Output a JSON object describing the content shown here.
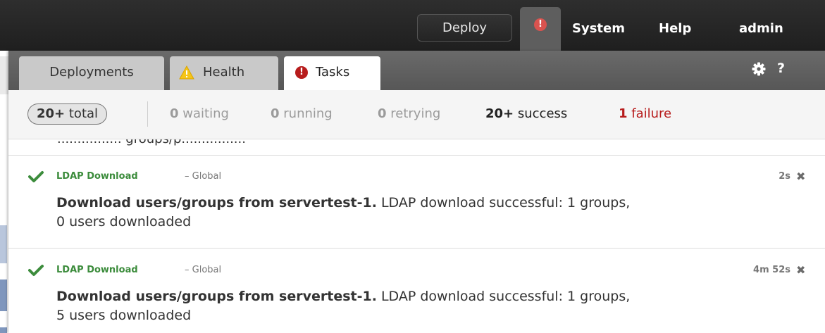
{
  "topbar": {
    "deploy_label": "Deploy",
    "alert_glyph": "!",
    "nav": {
      "system": "System",
      "help": "Help",
      "user": "admin"
    }
  },
  "tabs": {
    "deployments": "Deployments",
    "health": "Health",
    "tasks": "Tasks",
    "active": "Tasks",
    "help_glyph": "?"
  },
  "summary": {
    "total_count": "20+",
    "total_label": "total",
    "waiting_count": "0",
    "waiting_label": "waiting",
    "running_count": "0",
    "running_label": "running",
    "retrying_count": "0",
    "retrying_label": "retrying",
    "success_count": "20+",
    "success_label": "success",
    "failure_count": "1",
    "failure_label": "failure"
  },
  "tasks": [
    {
      "type": "LDAP Download",
      "scope": "– Global",
      "elapsed": "2s",
      "title": "Download users/groups from servertest-1.",
      "message": "LDAP download successful: 1 groups, 0 users downloaded",
      "status": "success"
    },
    {
      "type": "LDAP Download",
      "scope": "– Global",
      "elapsed": "4m 52s",
      "title": "Download users/groups from servertest-1.",
      "message": "LDAP download successful: 1 groups, 5 users downloaded",
      "status": "success"
    }
  ],
  "colors": {
    "topbar": "#242424",
    "success_green": "#3c8c3c",
    "failure_red": "#b71c1c",
    "warning_yellow": "#f5c518",
    "alert_red": "#d9534f"
  },
  "icons": {
    "alert": "exclamation-circle-icon",
    "warning": "warning-triangle-icon",
    "error": "error-circle-icon",
    "settings": "gear-icon",
    "help": "question-icon",
    "success": "checkmark-icon",
    "dismiss": "close-icon"
  }
}
